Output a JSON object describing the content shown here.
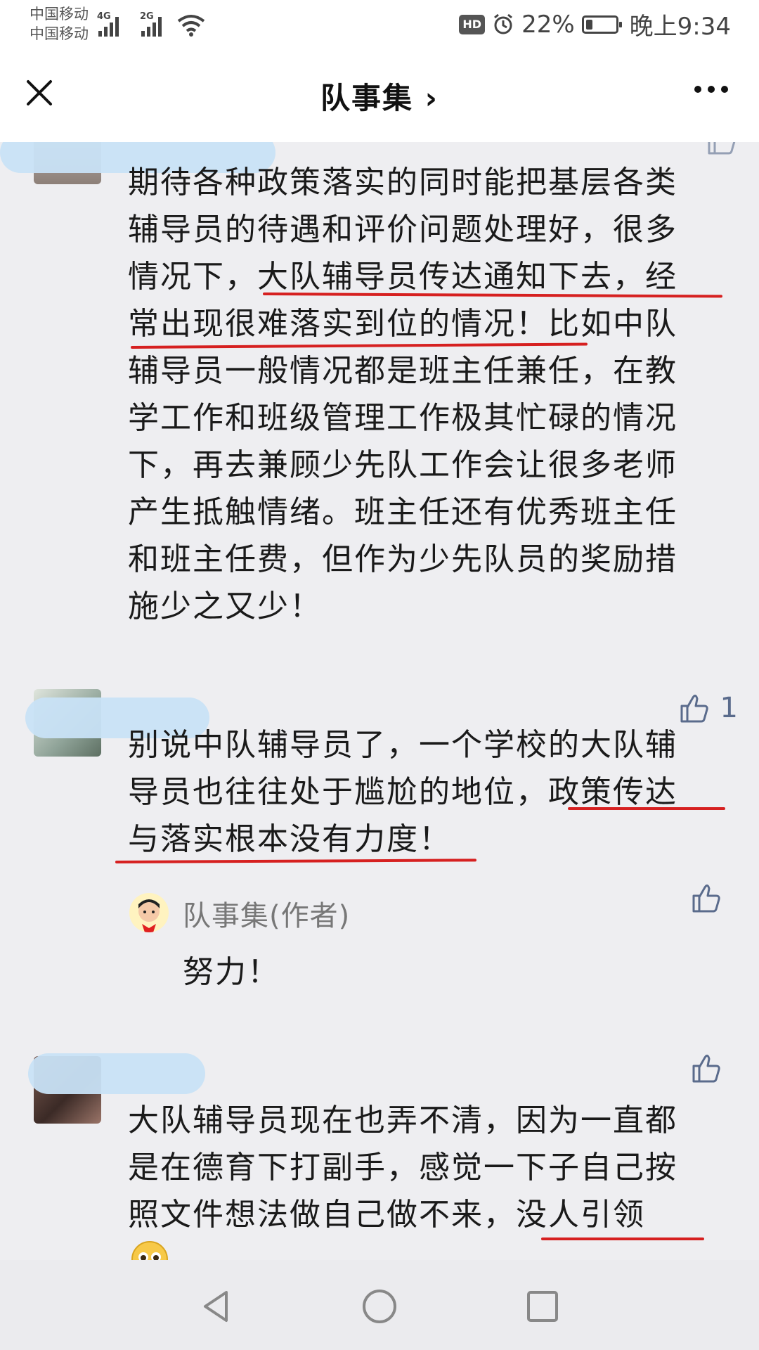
{
  "status_bar": {
    "carrier_1": "中国移动",
    "carrier_2": "中国移动",
    "net_1": "4G",
    "net_2": "2G",
    "hd": "HD",
    "battery": "22%",
    "battery_level": 0.22,
    "time": "晚上9:34"
  },
  "header": {
    "title": "队事集 ›",
    "close_icon": "close-icon",
    "more_icon": "more-icon"
  },
  "comments": [
    {
      "lines": [
        "期待各种政策落实的同时能把基层各类",
        "辅导员的待遇和评价问题处理好，很多",
        "情况下，大队辅导员传达通知下去，经",
        "常出现很难落实到位的情况！比如中队",
        "辅导员一般情况都是班主任兼任，在教",
        "学工作和班级管理工作极其忙碌的情况",
        "下，再去兼顾少先队工作会让很多老师",
        "产生抵触情绪。班主任还有优秀班主任",
        "和班主任费，但作为少先队员的奖励措",
        "施少之又少！"
      ]
    },
    {
      "likes": "1",
      "lines": [
        "别说中队辅导员了，一个学校的大队辅",
        "导员也往往处于尴尬的地位，政策传达",
        "与落实根本没有力度！"
      ],
      "reply": {
        "name": "队事集(作者)",
        "text": "努力！"
      }
    },
    {
      "lines": [
        "大队辅导员现在也弄不清，因为一直都",
        "是在德育下打副手，感觉一下子自己按",
        "照文件想法做自己做不来，没人引领"
      ],
      "emoji": "worried-face-emoji"
    }
  ],
  "nav": {
    "back_icon": "back-triangle-icon",
    "home_icon": "home-circle-icon",
    "recents_icon": "recents-square-icon"
  },
  "colors": {
    "background": "#eeeef1",
    "highlight_underline": "#d62020",
    "like_icon": "#5a6b8c",
    "name_blur": "#c8e2f6"
  }
}
